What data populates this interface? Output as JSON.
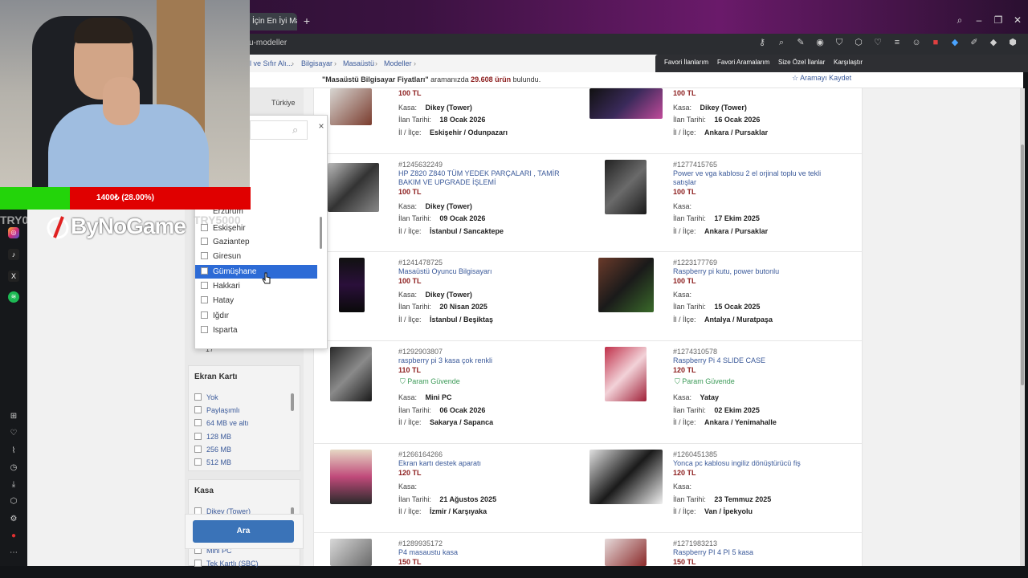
{
  "browser": {
    "tab_title": "İçin En İyi Ma...",
    "tab_plus": "+",
    "url": "u-modeller",
    "window_controls": [
      "search-icon",
      "minimize-icon",
      "restore-icon",
      "close-icon"
    ]
  },
  "breadcrumb": [
    "l ve Sıfır Alı...",
    "Bilgisayar",
    "Masaüstü",
    "Modeller"
  ],
  "topnav": [
    "Favori İlanlarım",
    "Favori Aramalarım",
    "Size Özel İlanlar",
    "Karşılaştır"
  ],
  "result": {
    "query": "\"Masaüstü Bilgisayar Fiyatları\"",
    "mid": " aramanızda ",
    "count": "29.608 ürün",
    "tail": " bulundu.",
    "save": "☆ Aramayı Kaydet"
  },
  "filters": {
    "turkiye": "Türkiye",
    "hidden_value": "17",
    "gpu_title": "Ekran Kartı",
    "gpu_options": [
      "Yok",
      "Paylaşımlı",
      "64 MB ve altı",
      "128 MB",
      "256 MB",
      "512 MB"
    ],
    "case_title": "Kasa",
    "case_options": [
      "Dikey (Tower)",
      "Mini PC",
      "Tek Kartlı (SBC)"
    ],
    "search_button": "Ara"
  },
  "city_popup": {
    "partial": "Erzurum",
    "cities": [
      "Eskişehir",
      "Gaziantep",
      "Giresun",
      "Gümüşhane",
      "Hakkari",
      "Hatay",
      "Iğdır",
      "Isparta"
    ],
    "selected": "Gümüşhane",
    "close": "×"
  },
  "listings": [
    {
      "id": "",
      "title": "",
      "price": "100 TL",
      "kasa": "Dikey (Tower)",
      "date": "18 Ocak 2026",
      "loc": "Eskişehir / Odunpazarı",
      "safe": ""
    },
    {
      "id": "",
      "title": "",
      "price": "100 TL",
      "kasa": "Dikey (Tower)",
      "date": "16 Ocak 2026",
      "loc": "Ankara / Pursaklar",
      "safe": ""
    },
    {
      "id": "#1245632249",
      "title": "HP Z820 Z840 TÜM YEDEK PARÇALARI , TAMİR BAKIM VE UPGRADE İŞLEMİ",
      "price": "100 TL",
      "kasa": "Dikey (Tower)",
      "date": "09 Ocak 2026",
      "loc": "İstanbul / Sancaktepe",
      "safe": ""
    },
    {
      "id": "#1277415765",
      "title": "Power ve vga kablosu 2 el orjinal toplu ve tekli satışlar",
      "price": "100 TL",
      "kasa": "",
      "date": "17 Ekim 2025",
      "loc": "Ankara / Pursaklar",
      "safe": ""
    },
    {
      "id": "#1241478725",
      "title": "Masaüstü Oyuncu Bilgisayarı",
      "price": "100 TL",
      "kasa": "Dikey (Tower)",
      "date": "20 Nisan 2025",
      "loc": "İstanbul / Beşiktaş",
      "safe": ""
    },
    {
      "id": "#1223177769",
      "title": "Raspberry pi kutu, power butonlu",
      "price": "100 TL",
      "kasa": "",
      "date": "15 Ocak 2025",
      "loc": "Antalya / Muratpaşa",
      "safe": ""
    },
    {
      "id": "#1292903807",
      "title": "raspberry pi 3 kasa çok renkli",
      "price": "110 TL",
      "kasa": "Mini PC",
      "date": "06 Ocak 2026",
      "loc": "Sakarya / Sapanca",
      "safe": "Param Güvende"
    },
    {
      "id": "#1274310578",
      "title": "Raspberry Pi 4 SLIDE CASE",
      "price": "120 TL",
      "kasa": "Yatay",
      "date": "02 Ekim 2025",
      "loc": "Ankara / Yenimahalle",
      "safe": "Param Güvende"
    },
    {
      "id": "#1266164266",
      "title": "Ekran kartı destek aparatı",
      "price": "120 TL",
      "kasa": "",
      "date": "21 Ağustos 2025",
      "loc": "İzmir / Karşıyaka",
      "safe": ""
    },
    {
      "id": "#1260451385",
      "title": "Yonca pc kablosu ingiliz dönüştürücü fiş",
      "price": "120 TL",
      "kasa": "",
      "date": "23 Temmuz 2025",
      "loc": "Van / İpekyolu",
      "safe": ""
    },
    {
      "id": "#1289935172",
      "title": "P4 masaustu kasa",
      "price": "150 TL",
      "kasa": "",
      "date": "",
      "loc": "",
      "safe": ""
    },
    {
      "id": "#1271983213",
      "title": "Raspberry PI 4 PI 5 kasa",
      "price": "150 TL",
      "kasa": "",
      "date": "",
      "loc": "",
      "safe": ""
    }
  ],
  "labels": {
    "kasa": "Kasa:",
    "date": "İlan Tarihi:",
    "loc": "İl / İlçe:"
  },
  "overlay": {
    "progress_text": "1400₺ (28.00%)",
    "progress_value": 0.28,
    "brand": "ByNoGame",
    "code1": "TRY0",
    "code2": "TRY5000",
    "progress_color": "#23d40a",
    "progress_bg": "#e00000"
  },
  "sidebar_icons": [
    "instagram-icon",
    "tiktok-icon",
    "x-icon",
    "spotify-icon",
    "grid-icon",
    "heart-icon",
    "chart-icon",
    "clock-icon",
    "download-icon",
    "box-icon",
    "settings-icon",
    "record-icon",
    "more-icon"
  ]
}
